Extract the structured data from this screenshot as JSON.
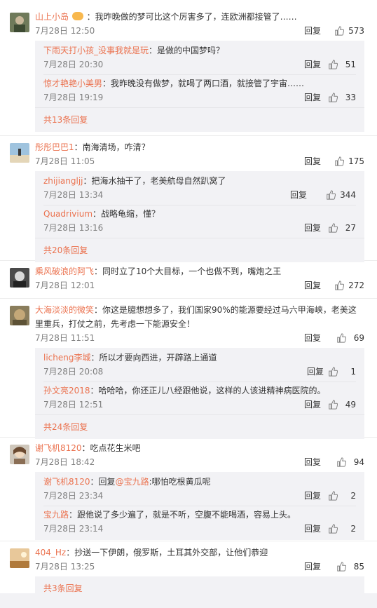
{
  "ui": {
    "reply_label": "回复"
  },
  "comments": [
    {
      "user": "山上小岛",
      "text": "：我昨晚做的梦可比这个厉害多了，连欧洲都接管了……",
      "time": "7月28日 12:50",
      "likes": "573",
      "replies": [
        {
          "user": "下雨天打小孩_没事我就是玩",
          "text": "：是做的中国梦吗？",
          "time": "7月28日 20:30",
          "likes": "51"
        },
        {
          "user": "惊才艳艳小美男",
          "text": "：我昨晚没有做梦，就喝了两口酒，就接管了宇宙……",
          "time": "7月28日 19:19",
          "likes": "33"
        }
      ],
      "more": "共13条回复"
    },
    {
      "user": "彤彤巴巴1",
      "text": "：南海清场，咋清？",
      "time": "7月28日 11:05",
      "likes": "175",
      "replies": [
        {
          "user": "zhijiangljj",
          "text": "：把海水抽干了，老美航母自然趴窝了",
          "time": "7月28日 13:34",
          "likes": "344"
        },
        {
          "user": "Quadrivium",
          "text": "：战略龟缩，懂？",
          "time": "7月28日 13:16",
          "likes": "27"
        }
      ],
      "more": "共20条回复"
    },
    {
      "user": "乘风破浪的阿飞",
      "text": "：同时立了10个大目标，一个也做不到，嘴炮之王",
      "time": "7月28日 12:01",
      "likes": "272",
      "replies": [],
      "more": ""
    },
    {
      "user": "大海淡淡的微笑",
      "text": "：你这是臆想想多了，我们国家90%的能源要经过马六甲海峡，老美这里重兵，打仗之前，先考虑一下能源安全！",
      "time": "7月28日 11:51",
      "likes": "69",
      "replies": [
        {
          "user": "licheng李城",
          "text": "：所以才要向西进，开辟路上通道",
          "time": "7月28日 20:08",
          "likes": "1"
        },
        {
          "user": "孙文亮2018",
          "text": "：哈哈哈，你还正儿八经跟他说，这样的人该进精神病医院的。",
          "time": "7月28日 12:51",
          "likes": "49"
        }
      ],
      "more": "共24条回复"
    },
    {
      "user": "谢飞机8120",
      "text": "：吃点花生米吧",
      "time": "7月28日 18:42",
      "likes": "94",
      "replies": [
        {
          "user": "谢飞机8120",
          "text": "：回复",
          "mention": "@宝九路",
          "text2": ":哪怕吃根黄瓜呢",
          "time": "7月28日 23:34",
          "likes": "2"
        },
        {
          "user": "宝九路",
          "text": "：跟他说了多少遍了，就是不听，空腹不能喝酒，容易上头。",
          "time": "7月28日 23:14",
          "likes": "2"
        }
      ],
      "more": ""
    },
    {
      "user": "404_Hz",
      "text": "：抄送一下伊朗，俄罗斯，土耳其外交部，让他们恭迎",
      "time": "7月28日 13:25",
      "likes": "85",
      "replies": [],
      "more": "共3条回复"
    }
  ],
  "colors": {
    "username": "#eb7350",
    "reply_bg": "#f2f2f5",
    "muted": "#808080"
  }
}
